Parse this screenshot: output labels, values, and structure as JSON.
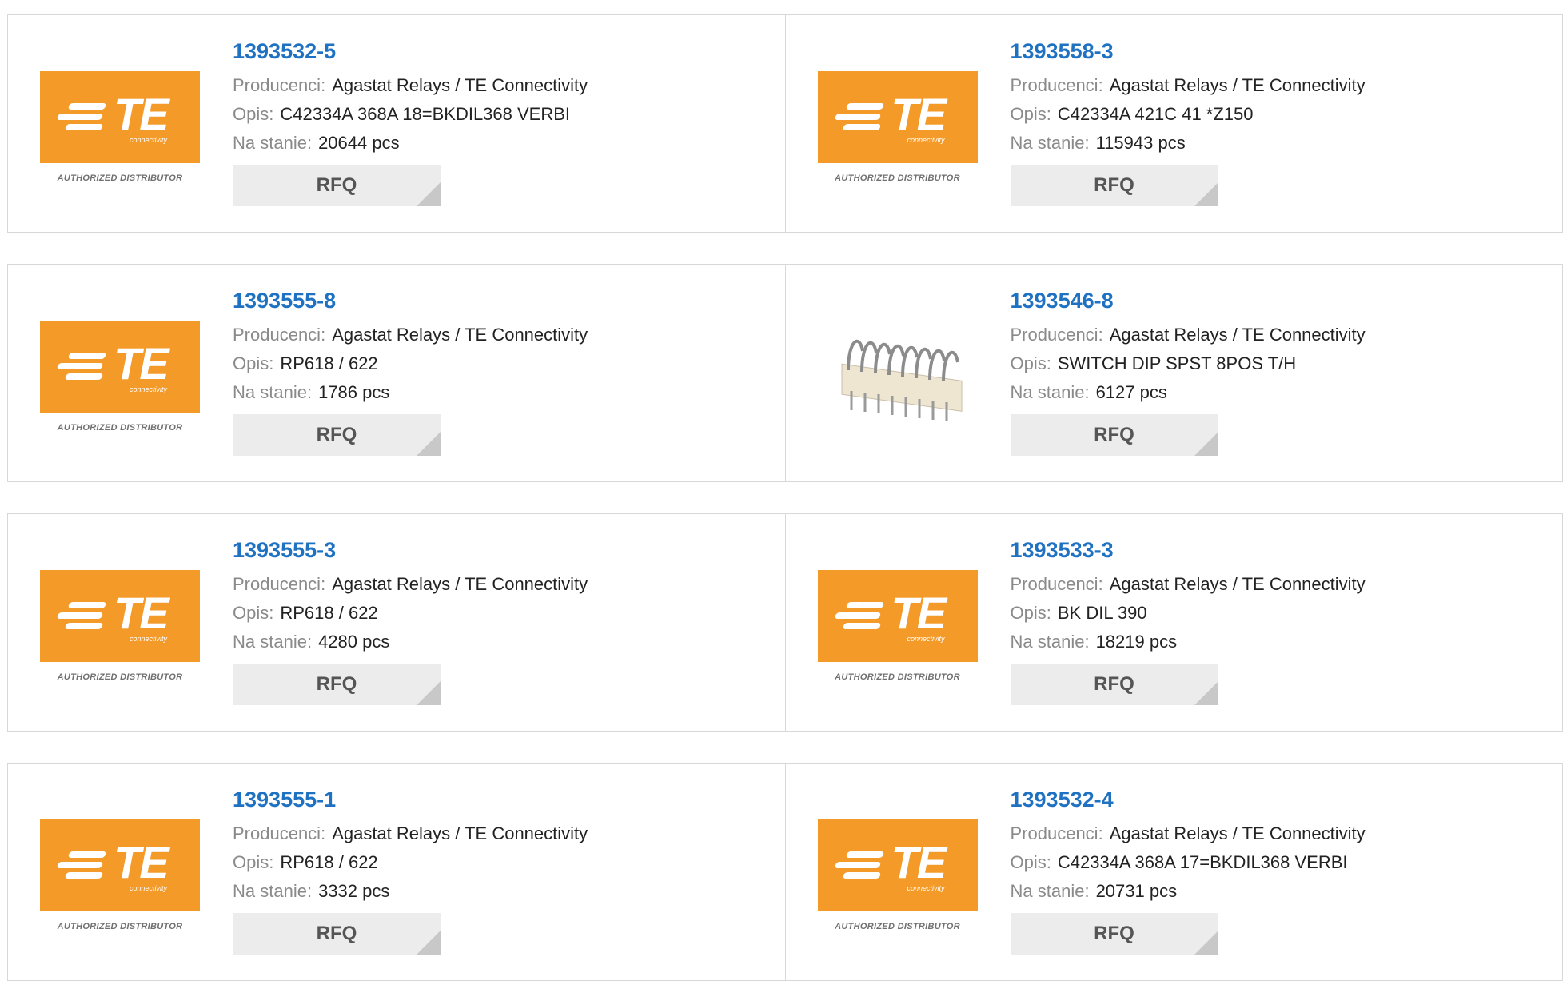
{
  "labels": {
    "manufacturer": "Producenci:",
    "description": "Opis:",
    "stock": "Na stanie:",
    "rfq": "RFQ",
    "logo_text": "TE",
    "logo_sub": "connectivity",
    "authorized": "AUTHORIZED DISTRIBUTOR"
  },
  "colors": {
    "accent": "#1f72c2",
    "logo_orange": "#f39a29"
  },
  "rows": [
    {
      "cards": [
        {
          "part": "1393532-5",
          "manufacturer": "Agastat Relays / TE Connectivity",
          "description": "C42334A 368A 18=BKDIL368 VERBI",
          "stock": "20644 pcs",
          "image": "te-logo"
        },
        {
          "part": "1393558-3",
          "manufacturer": "Agastat Relays / TE Connectivity",
          "description": "C42334A 421C 41 *Z150",
          "stock": "115943 pcs",
          "image": "te-logo"
        }
      ]
    },
    {
      "cards": [
        {
          "part": "1393555-8",
          "manufacturer": "Agastat Relays / TE Connectivity",
          "description": "RP618 / 622",
          "stock": "1786 pcs",
          "image": "te-logo"
        },
        {
          "part": "1393546-8",
          "manufacturer": "Agastat Relays / TE Connectivity",
          "description": "SWITCH DIP SPST 8POS T/H",
          "stock": "6127 pcs",
          "image": "dip-switch-photo"
        }
      ]
    },
    {
      "cards": [
        {
          "part": "1393555-3",
          "manufacturer": "Agastat Relays / TE Connectivity",
          "description": "RP618 / 622",
          "stock": "4280 pcs",
          "image": "te-logo"
        },
        {
          "part": "1393533-3",
          "manufacturer": "Agastat Relays / TE Connectivity",
          "description": "BK DIL 390",
          "stock": "18219 pcs",
          "image": "te-logo"
        }
      ]
    },
    {
      "cards": [
        {
          "part": "1393555-1",
          "manufacturer": "Agastat Relays / TE Connectivity",
          "description": "RP618 / 622",
          "stock": "3332 pcs",
          "image": "te-logo"
        },
        {
          "part": "1393532-4",
          "manufacturer": "Agastat Relays / TE Connectivity",
          "description": "C42334A 368A 17=BKDIL368 VERBI",
          "stock": "20731 pcs",
          "image": "te-logo"
        }
      ]
    }
  ]
}
